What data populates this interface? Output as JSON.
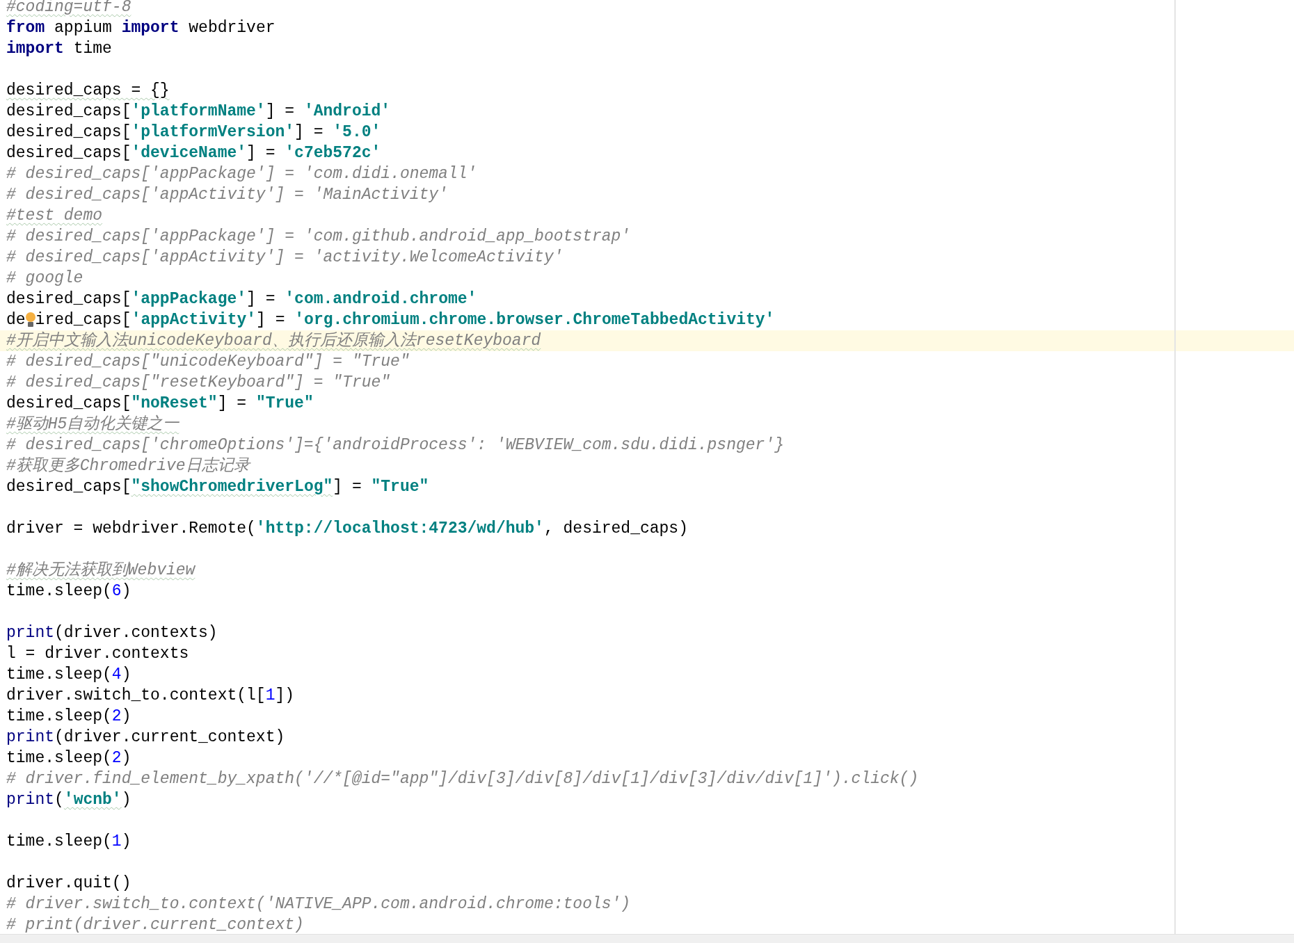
{
  "editor": {
    "lines": [
      {
        "tokens": [
          {
            "kind": "comment",
            "text": "#coding=utf-8",
            "typo": true
          }
        ]
      },
      {
        "tokens": [
          {
            "kind": "keyword",
            "text": "from"
          },
          {
            "kind": "plain",
            "text": " appium "
          },
          {
            "kind": "keyword",
            "text": "import"
          },
          {
            "kind": "plain",
            "text": " webdriver"
          }
        ]
      },
      {
        "tokens": [
          {
            "kind": "keyword",
            "text": "import"
          },
          {
            "kind": "plain",
            "text": " time"
          }
        ]
      },
      {
        "space_above": true,
        "tokens": [
          {
            "kind": "plain",
            "text": "desired_caps = {}",
            "typo": true
          }
        ]
      },
      {
        "tokens": [
          {
            "kind": "plain",
            "text": "desired_caps["
          },
          {
            "kind": "string",
            "text": "'platformName'"
          },
          {
            "kind": "plain",
            "text": "] = "
          },
          {
            "kind": "string",
            "text": "'Android'"
          }
        ]
      },
      {
        "tokens": [
          {
            "kind": "plain",
            "text": "desired_caps["
          },
          {
            "kind": "string",
            "text": "'platformVersion'"
          },
          {
            "kind": "plain",
            "text": "] = "
          },
          {
            "kind": "string",
            "text": "'5.0'"
          }
        ]
      },
      {
        "tokens": [
          {
            "kind": "plain",
            "text": "desired_caps["
          },
          {
            "kind": "string",
            "text": "'deviceName'"
          },
          {
            "kind": "plain",
            "text": "] = "
          },
          {
            "kind": "string",
            "text": "'c7eb572c'"
          }
        ]
      },
      {
        "tokens": [
          {
            "kind": "comment",
            "text": "# desired_caps['appPackage'] = 'com.didi.onemall'"
          }
        ]
      },
      {
        "tokens": [
          {
            "kind": "comment",
            "text": "# desired_caps['appActivity'] = 'MainActivity'"
          }
        ]
      },
      {
        "tokens": [
          {
            "kind": "comment",
            "text": "#test demo",
            "typo": true
          }
        ]
      },
      {
        "tokens": [
          {
            "kind": "comment",
            "text": "# desired_caps['appPackage'] = 'com.github.android_app_bootstrap'"
          }
        ]
      },
      {
        "tokens": [
          {
            "kind": "comment",
            "text": "# desired_caps['appActivity'] = 'activity.WelcomeActivity'"
          }
        ]
      },
      {
        "tokens": [
          {
            "kind": "comment",
            "text": "# google"
          }
        ]
      },
      {
        "tokens": [
          {
            "kind": "plain",
            "text": "desired_caps["
          },
          {
            "kind": "string",
            "text": "'appPackage'"
          },
          {
            "kind": "plain",
            "text": "] = "
          },
          {
            "kind": "string",
            "text": "'com.android.chrome'"
          }
        ]
      },
      {
        "tokens": [
          {
            "kind": "plain",
            "text": "de"
          },
          {
            "kind": "bulb"
          },
          {
            "kind": "plain",
            "text": "ired_caps["
          },
          {
            "kind": "string",
            "text": "'appActivity'"
          },
          {
            "kind": "plain",
            "text": "] = "
          },
          {
            "kind": "string",
            "text": "'org.chromium.chrome.browser.ChromeTabbedActivity'"
          }
        ]
      },
      {
        "current": true,
        "tokens": [
          {
            "kind": "comment",
            "text": "#开启中文输入法unicodeKeyboard、执行后还原输入法resetKeyboard",
            "typo": true
          }
        ]
      },
      {
        "tokens": [
          {
            "kind": "comment",
            "text": "# desired_caps[\"unicodeKeyboard\"] = \"True\""
          }
        ]
      },
      {
        "tokens": [
          {
            "kind": "comment",
            "text": "# desired_caps[\"resetKeyboard\"] = \"True\""
          }
        ]
      },
      {
        "tokens": [
          {
            "kind": "plain",
            "text": "desired_caps["
          },
          {
            "kind": "string",
            "text": "\"noReset\""
          },
          {
            "kind": "plain",
            "text": "] = "
          },
          {
            "kind": "string",
            "text": "\"True\""
          }
        ]
      },
      {
        "tokens": [
          {
            "kind": "comment",
            "text": "#驱动H5自动化关键之一",
            "typo": true
          }
        ]
      },
      {
        "tokens": [
          {
            "kind": "comment",
            "text": "# desired_caps['chromeOptions']={'androidProcess': 'WEBVIEW_com.sdu.didi.psnger'}"
          }
        ]
      },
      {
        "tokens": [
          {
            "kind": "comment",
            "text": "#获取更多Chromedrive日志记录"
          }
        ]
      },
      {
        "tokens": [
          {
            "kind": "plain",
            "text": "desired_caps["
          },
          {
            "kind": "string",
            "text": "\"showChromedriverLog\"",
            "typo": true
          },
          {
            "kind": "plain",
            "text": "] = "
          },
          {
            "kind": "string",
            "text": "\"True\""
          }
        ]
      },
      {
        "space_above": true,
        "tokens": [
          {
            "kind": "plain",
            "text": "driver = webdriver.Remote("
          },
          {
            "kind": "string",
            "text": "'http://localhost:4723/wd/hub'"
          },
          {
            "kind": "plain",
            "text": ", desired_caps)"
          }
        ]
      },
      {
        "space_above": true,
        "tokens": [
          {
            "kind": "comment",
            "text": "#解决无法获取到Webview",
            "typo": true
          }
        ]
      },
      {
        "tokens": [
          {
            "kind": "plain",
            "text": "time.sleep("
          },
          {
            "kind": "number",
            "text": "6"
          },
          {
            "kind": "plain",
            "text": ")"
          }
        ]
      },
      {
        "space_above": true,
        "tokens": [
          {
            "kind": "builtin",
            "text": "print"
          },
          {
            "kind": "plain",
            "text": "(driver.contexts)"
          }
        ]
      },
      {
        "tokens": [
          {
            "kind": "plain",
            "text": "l = driver.contexts"
          }
        ]
      },
      {
        "tokens": [
          {
            "kind": "plain",
            "text": "time.sleep("
          },
          {
            "kind": "number",
            "text": "4"
          },
          {
            "kind": "plain",
            "text": ")"
          }
        ]
      },
      {
        "tokens": [
          {
            "kind": "plain",
            "text": "driver.switch_to.context(l["
          },
          {
            "kind": "number",
            "text": "1"
          },
          {
            "kind": "plain",
            "text": "])"
          }
        ]
      },
      {
        "tokens": [
          {
            "kind": "plain",
            "text": "time.sleep("
          },
          {
            "kind": "number",
            "text": "2"
          },
          {
            "kind": "plain",
            "text": ")"
          }
        ]
      },
      {
        "tokens": [
          {
            "kind": "builtin",
            "text": "print"
          },
          {
            "kind": "plain",
            "text": "(driver.current_context)"
          }
        ]
      },
      {
        "tokens": [
          {
            "kind": "plain",
            "text": "time.sleep("
          },
          {
            "kind": "number",
            "text": "2"
          },
          {
            "kind": "plain",
            "text": ")"
          }
        ]
      },
      {
        "tokens": [
          {
            "kind": "comment",
            "text": "# driver.find_element_by_xpath('//*[@id=\"app\"]/div[3]/div[8]/div[1]/div[3]/div/div[1]').click()"
          }
        ]
      },
      {
        "tokens": [
          {
            "kind": "builtin",
            "text": "print"
          },
          {
            "kind": "plain",
            "text": "("
          },
          {
            "kind": "string",
            "text": "'wcnb'",
            "typo": true
          },
          {
            "kind": "plain",
            "text": ")"
          }
        ]
      },
      {
        "space_above": true,
        "tokens": [
          {
            "kind": "plain",
            "text": "time.sleep("
          },
          {
            "kind": "number",
            "text": "1"
          },
          {
            "kind": "plain",
            "text": ")"
          }
        ]
      },
      {
        "space_above": true,
        "tokens": [
          {
            "kind": "plain",
            "text": "driver.quit()"
          }
        ]
      },
      {
        "tokens": [
          {
            "kind": "comment",
            "text": "# driver.switch_to.context('NATIVE_APP.com.android.chrome:tools')"
          }
        ]
      },
      {
        "tokens": [
          {
            "kind": "comment",
            "text": "# print(driver.current_context)"
          }
        ]
      }
    ]
  }
}
